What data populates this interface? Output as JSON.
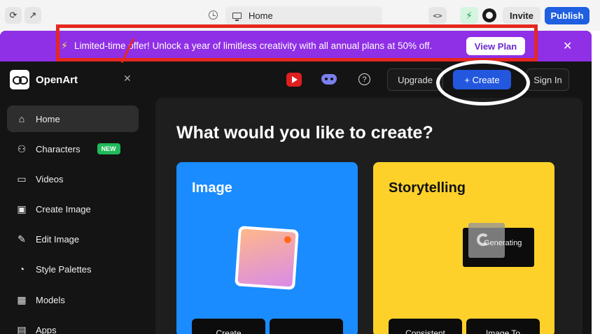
{
  "browser": {
    "url_title": "Home",
    "invite_label": "Invite",
    "publish_label": "Publish",
    "code_label": "<>"
  },
  "promo": {
    "text": "Limited-time offer!  Unlock a year of limitless creativity with all annual plans at 50% off.",
    "button_label": "View Plan",
    "close_glyph": "✕",
    "icon_glyph": "⚡"
  },
  "brand": {
    "name": "OpenArt",
    "collapse_glyph": "✕"
  },
  "sidebar": {
    "items": [
      {
        "label": "Home",
        "icon": "⌂",
        "active": true
      },
      {
        "label": "Characters",
        "icon": "⚇",
        "badge": "NEW"
      },
      {
        "label": "Videos",
        "icon": "▭"
      },
      {
        "label": "Create Image",
        "icon": "▣"
      },
      {
        "label": "Edit Image",
        "icon": "✎"
      },
      {
        "label": "Style Palettes",
        "icon": "◔"
      },
      {
        "label": "Models",
        "icon": "▦"
      },
      {
        "label": "Apps",
        "icon": "▤"
      }
    ]
  },
  "header": {
    "help_glyph": "?",
    "upgrade_label": "Upgrade",
    "create_label": "+ Create",
    "signin_label": "Sign In"
  },
  "main": {
    "headline": "What would you like to create?",
    "cards": [
      {
        "title": "Image",
        "buttons": [
          "Create",
          ""
        ]
      },
      {
        "title": "Storytelling",
        "status": "Generating",
        "buttons": [
          "Consistent",
          "Image To"
        ]
      }
    ]
  },
  "colors": {
    "promo_bg": "#8f2fe6",
    "accent_blue": "#2257de",
    "image_card": "#1a8cff",
    "story_card": "#fdd12a",
    "annotation_red": "#e5281f"
  }
}
